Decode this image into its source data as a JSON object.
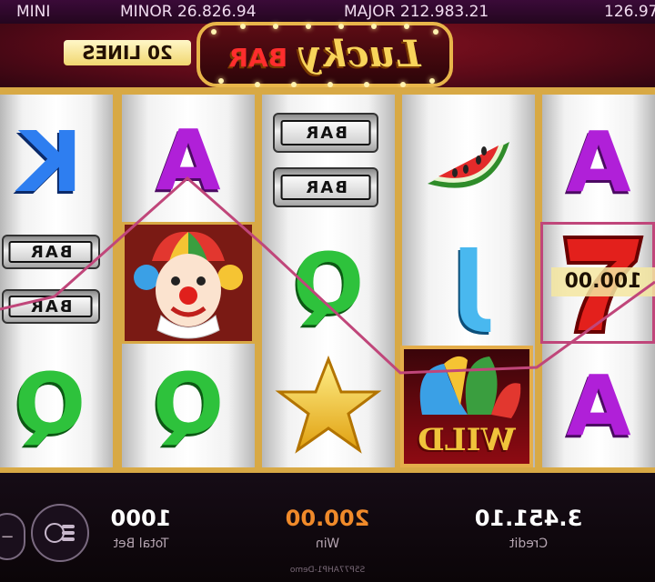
{
  "jackpots": {
    "mini_label": "MINI",
    "minor_text": "MINOR 26.826.94",
    "major_text": "MAJOR 212.983.21",
    "grand_partial": "126.97"
  },
  "header": {
    "lines_label": "20 LINES",
    "logo_script": "Lucky",
    "logo_bar": "BAR"
  },
  "reels": [
    [
      "K",
      "BAR BAR",
      "Q"
    ],
    [
      "A",
      "clown",
      "Q"
    ],
    [
      "BAR BAR",
      "Q",
      "star"
    ],
    [
      "watermelon",
      "J",
      "WILD"
    ],
    [
      "A",
      "7",
      "A"
    ]
  ],
  "symbols": {
    "bar_label": "BAR",
    "wild_label": "WILD",
    "win_amount": "100.00"
  },
  "colors": {
    "frame_gold": "#d8a945",
    "win_line": "#c0467a",
    "win_color": "#f08a2a",
    "credit_color": "#ffffff"
  },
  "bottom": {
    "total_bet_value": "1000",
    "total_bet_label": "Total Bet",
    "win_value": "200.00",
    "win_label": "Win",
    "credit_value": "3.451.10",
    "credit_label": "Credit",
    "footer_note": "S5P77AHP1-Demo"
  }
}
